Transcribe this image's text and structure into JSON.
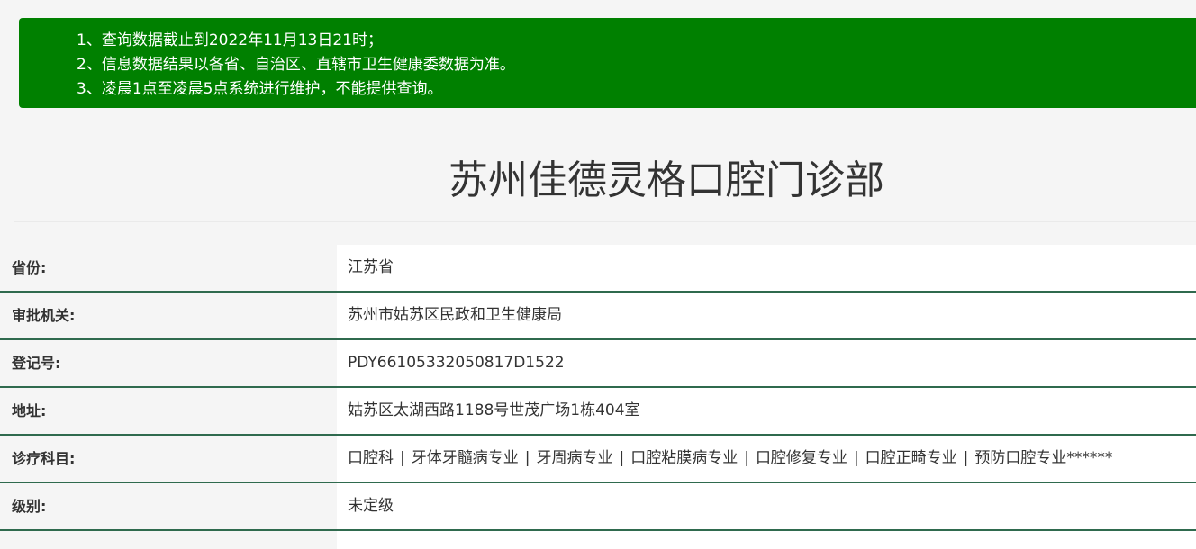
{
  "notice": {
    "lines": [
      "1、查询数据截止到2022年11月13日21时；",
      "2、信息数据结果以各省、自治区、直辖市卫生健康委数据为准。",
      "3、凌晨1点至凌晨5点系统进行维护，不能提供查询。"
    ]
  },
  "title": "苏州佳德灵格口腔门诊部",
  "rows": [
    {
      "label": "省份:",
      "value": "江苏省"
    },
    {
      "label": "审批机关:",
      "value": "苏州市姑苏区民政和卫生健康局"
    },
    {
      "label": "登记号:",
      "value": "PDY66105332050817D1522"
    },
    {
      "label": "地址:",
      "value": "姑苏区太湖西路1188号世茂广场1栋404室"
    },
    {
      "label": "诊疗科目:",
      "value": ""
    },
    {
      "label": "级别:",
      "value": "未定级"
    }
  ],
  "departments": [
    "口腔科",
    "牙体牙髓病专业",
    "牙周病专业",
    "口腔粘膜病专业",
    "口腔修复专业",
    "口腔正畸专业",
    "预防口腔专业******"
  ],
  "separator": "|",
  "colors": {
    "notice_bg": "#008000",
    "row_border": "#2f6a4e"
  }
}
